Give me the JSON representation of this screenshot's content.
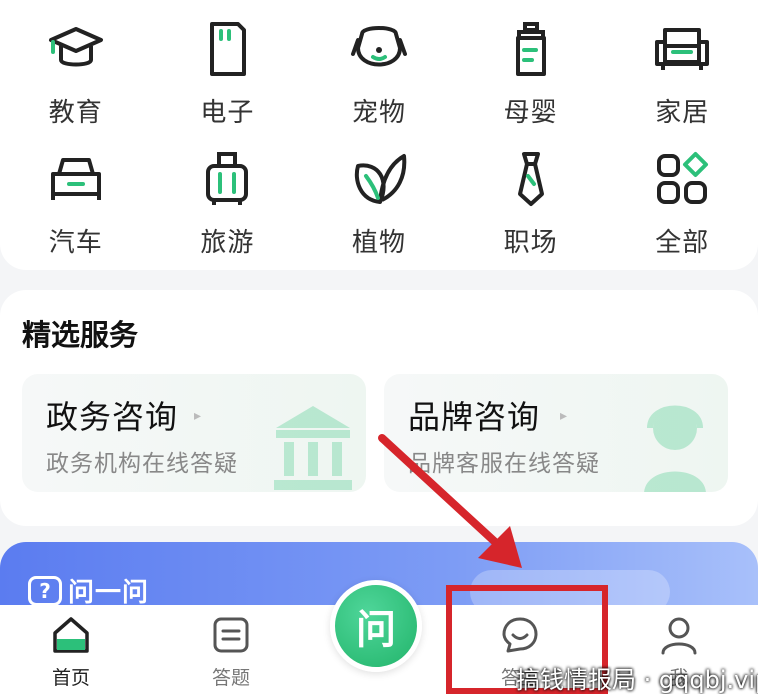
{
  "categories": [
    {
      "label": "教育",
      "icon": "graduation-cap-icon"
    },
    {
      "label": "电子",
      "icon": "sd-card-icon"
    },
    {
      "label": "宠物",
      "icon": "pet-face-icon"
    },
    {
      "label": "母婴",
      "icon": "baby-bottle-icon"
    },
    {
      "label": "家居",
      "icon": "sofa-icon"
    },
    {
      "label": "汽车",
      "icon": "car-icon"
    },
    {
      "label": "旅游",
      "icon": "suitcase-icon"
    },
    {
      "label": "植物",
      "icon": "leaf-icon"
    },
    {
      "label": "职场",
      "icon": "tie-icon"
    },
    {
      "label": "全部",
      "icon": "all-grid-icon"
    }
  ],
  "services": {
    "title": "精选服务",
    "items": [
      {
        "name": "政务咨询",
        "desc": "政务机构在线答疑",
        "icon": "government-building-icon"
      },
      {
        "name": "品牌咨询",
        "desc": "品牌客服在线答疑",
        "icon": "customer-service-icon"
      }
    ]
  },
  "banner": {
    "label": "问一问",
    "logo_glyph": "?"
  },
  "nav": {
    "home": "首页",
    "answer": "答题",
    "ask": "问",
    "answerer": "答主",
    "me": "我"
  },
  "watermark": "搞钱情报局 · gqqbj.vip",
  "colors": {
    "accent": "#22b46a",
    "annotation": "#d6252b",
    "banner": "#5b7cf0"
  }
}
